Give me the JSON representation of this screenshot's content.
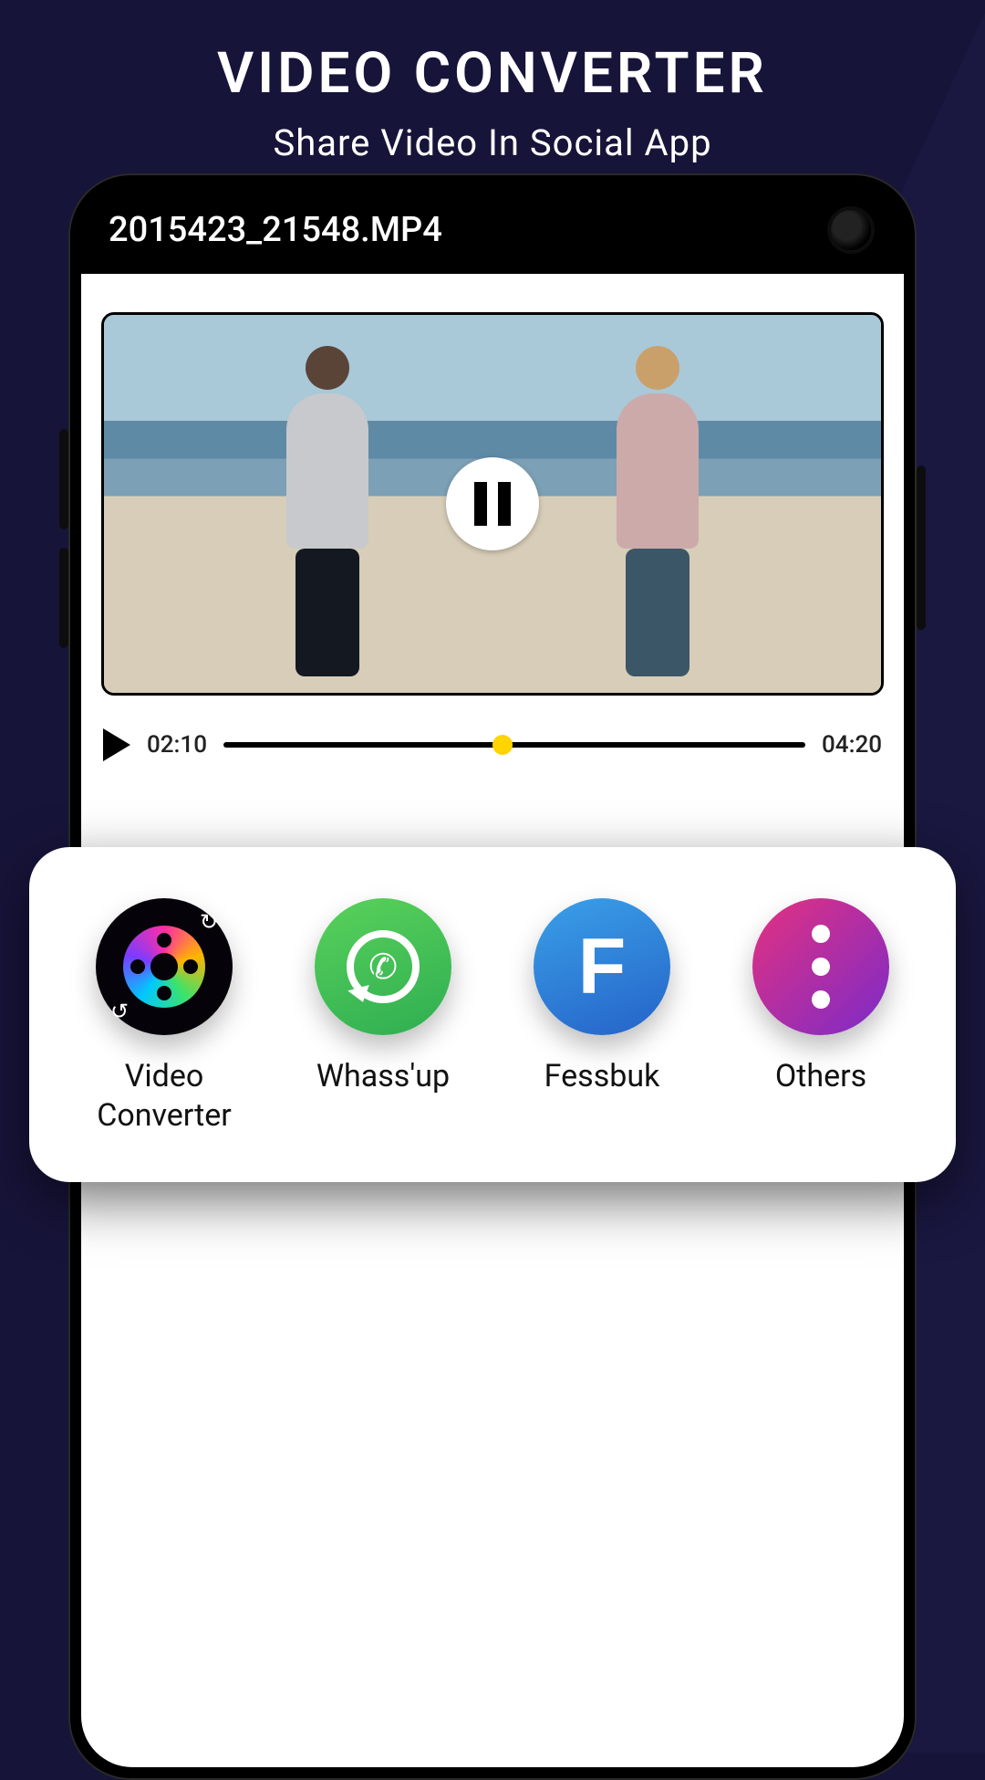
{
  "header": {
    "title": "VIDEO CONVERTER",
    "subtitle": "Share Video In Social App"
  },
  "topbar": {
    "filename": "2015423_21548.MP4"
  },
  "player": {
    "state_icon": "pause-icon",
    "current_time": "02:10",
    "total_time": "04:20",
    "progress_percent": 48
  },
  "share": {
    "items": [
      {
        "id": "video-converter",
        "label": "Video Converter",
        "icon": "film-reel-icon"
      },
      {
        "id": "whassup",
        "label": "Whass'up",
        "icon": "chat-phone-icon"
      },
      {
        "id": "fessbuk",
        "label": "Fessbuk",
        "icon": "letter-f-icon"
      },
      {
        "id": "others",
        "label": "Others",
        "icon": "more-dots-icon"
      }
    ]
  },
  "colors": {
    "background": "#17143a",
    "knob": "#ffd400"
  }
}
